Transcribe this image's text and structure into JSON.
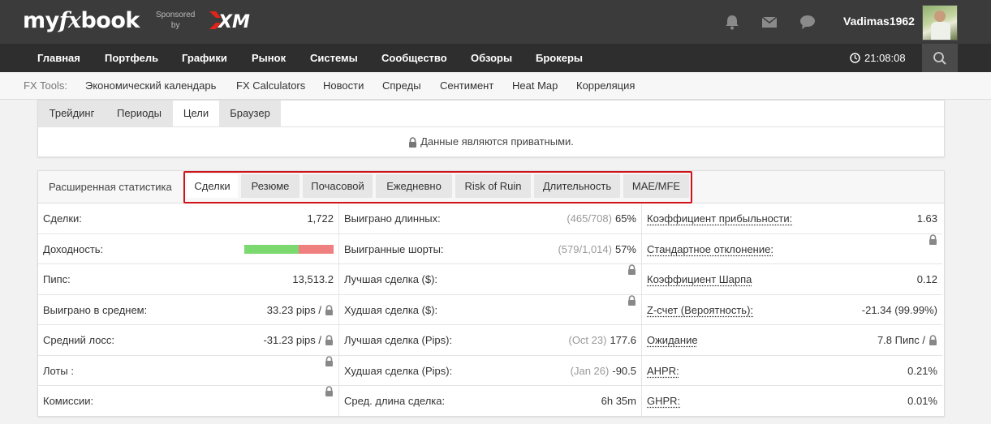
{
  "header": {
    "logo": {
      "my": "my",
      "fx": "fx",
      "book": "book"
    },
    "sponsored": {
      "line1": "Sponsored",
      "line2": "by"
    },
    "username": "Vadimas1962",
    "icons": [
      "bell-icon",
      "mail-icon",
      "chat-icon"
    ]
  },
  "nav": {
    "items": [
      "Главная",
      "Портфель",
      "Графики",
      "Рынок",
      "Системы",
      "Сообщество",
      "Обзоры",
      "Брокеры"
    ],
    "clock": "21:08:08"
  },
  "tools": {
    "label": "FX Tools:",
    "items": [
      "Экономический календарь",
      "FX Calculators",
      "Новости",
      "Спреды",
      "Сентимент",
      "Heat Map",
      "Корреляция"
    ]
  },
  "panel1": {
    "tabs": [
      "Трейдинг",
      "Периоды",
      "Цели",
      "Браузер"
    ],
    "active_tab": "Цели",
    "private_message": "Данные являются приватными."
  },
  "panel2": {
    "label": "Расширенная статистика",
    "tabs": [
      "Сделки",
      "Резюме",
      "Почасовой",
      "Ежедневно",
      "Risk of Ruin",
      "Длительность",
      "MAE/MFE"
    ],
    "active_tab": "Сделки",
    "col1": [
      {
        "label": "Сделки:",
        "value": "1,722"
      },
      {
        "label": "Доходность:",
        "bar_green_fraction": 0.61
      },
      {
        "label": "Пипс:",
        "value": "13,513.2"
      },
      {
        "label": "Выиграно в среднем:",
        "value": "33.23 pips /"
      },
      {
        "label": "Средний лосс:",
        "value": "-31.23 pips /"
      },
      {
        "label": "Лоты :"
      },
      {
        "label": "Комиссии:"
      }
    ],
    "col2": [
      {
        "label": "Выиграно длинных:",
        "muted": "(465/708)",
        "value": "65%"
      },
      {
        "label": "Выигранные шорты:",
        "muted": "(579/1,014)",
        "value": "57%"
      },
      {
        "label": "Лучшая сделка ($):"
      },
      {
        "label": "Худшая сделка ($):"
      },
      {
        "label": "Лучшая сделка (Pips):",
        "muted": "(Oct 23)",
        "value": "177.6"
      },
      {
        "label": "Худшая сделка (Pips):",
        "muted": "(Jan 26)",
        "value": "-90.5"
      },
      {
        "label": "Сред. длина сделка:",
        "value": "6h 35m"
      }
    ],
    "col3": [
      {
        "label": "Коэффициент прибыльности:",
        "value": "1.63"
      },
      {
        "label": "Стандартное отклонение:"
      },
      {
        "label": "Коэффициент Шарпа",
        "value": "0.12"
      },
      {
        "label": "Z-счет (Вероятность):",
        "value": "-21.34 (99.99%)"
      },
      {
        "label": "Ожидание",
        "value": "7.8 Пипс /"
      },
      {
        "label": "AHPR:",
        "value": "0.21%"
      },
      {
        "label": "GHPR:",
        "value": "0.01%"
      }
    ]
  },
  "colors": {
    "highlight": "#d0121b",
    "bar_green": "#7bd96f",
    "bar_red": "#f07f7f"
  }
}
